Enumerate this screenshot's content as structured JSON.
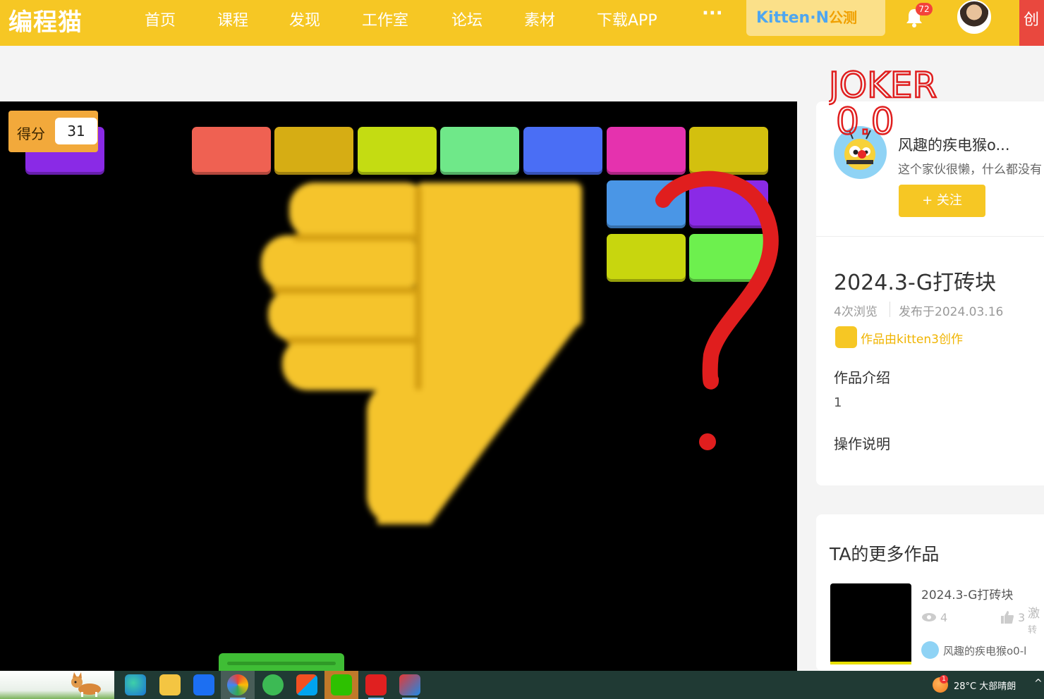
{
  "nav": {
    "logo": "编程猫",
    "items": [
      "首页",
      "课程",
      "发现",
      "工作室",
      "论坛",
      "素材",
      "下载APP"
    ],
    "more": "···",
    "kitten_brand": "Kitten·N",
    "kitten_tag": "公测",
    "notification_count": "72",
    "red_tab_text": "创"
  },
  "game": {
    "score_label": "得分",
    "score_value": "31",
    "brick_colors": {
      "row1": [
        "#ef6152",
        "#d6ad14",
        "#c4dc12",
        "#6fe889",
        "#4a6ef5",
        "#e532ae",
        "#d3c00e"
      ],
      "row2": [
        "#4a96e6",
        "#8a2ae6"
      ],
      "row3": [
        "#c8d60e",
        "#6df04e"
      ],
      "extra": "#8a2ae6"
    }
  },
  "annotation": {
    "joker_text": "JOKER",
    "joker_sub": "0.0"
  },
  "author": {
    "name": "风趣的疾电猴o...",
    "bio": "这个家伙很懒，什么都没有",
    "follow_label": "+ 关注"
  },
  "work": {
    "title": "2024.3-G打砖块",
    "views": "4次浏览",
    "published": "发布于2024.03.16",
    "made_by": "作品由kitten3创作",
    "intro_heading": "作品介绍",
    "intro_text": "1",
    "ops_heading": "操作说明"
  },
  "more_works": {
    "heading": "TA的更多作品",
    "items": [
      {
        "title": "2024.3-G打砖块",
        "views": "4",
        "likes": "3",
        "extra_top": "激",
        "extra_bottom": "转",
        "author": "风趣的疾电猴o0-l"
      }
    ]
  },
  "taskbar": {
    "weather_badge": "1",
    "weather_text": "28°C  大部晴朗",
    "tray_chevron": "^"
  }
}
